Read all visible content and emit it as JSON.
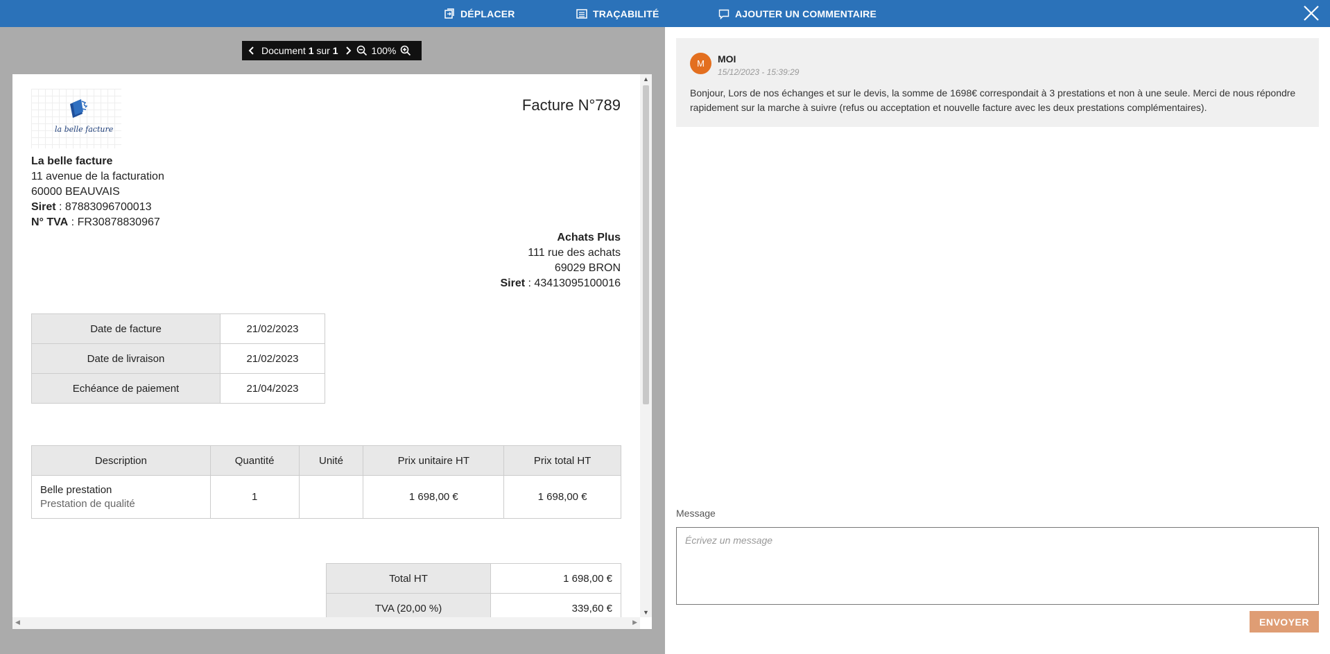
{
  "topbar": {
    "move_label": "DÉPLACER",
    "traceability_label": "TRAÇABILITÉ",
    "add_comment_label": "AJOUTER UN COMMENTAIRE"
  },
  "viewer": {
    "document_word": "Document",
    "current_page": "1",
    "of_word": "sur",
    "total_pages": "1",
    "zoom": "100%"
  },
  "invoice": {
    "title": "Facture N°789",
    "logo_text": "la belle facture",
    "sender": {
      "name": "La belle facture",
      "address1": "11 avenue de la facturation",
      "address2": "60000 BEAUVAIS",
      "siret_label": "Siret",
      "siret": "87883096700013",
      "vat_label": "N° TVA",
      "vat": "FR30878830967"
    },
    "recipient": {
      "name": "Achats Plus",
      "address1": "111 rue des achats",
      "address2": "69029 BRON",
      "siret_label": "Siret",
      "siret": "43413095100016"
    },
    "dates": [
      {
        "label": "Date de facture",
        "value": "21/02/2023"
      },
      {
        "label": "Date de livraison",
        "value": "21/02/2023"
      },
      {
        "label": "Echéance de paiement",
        "value": "21/04/2023"
      }
    ],
    "items_headers": [
      "Description",
      "Quantité",
      "Unité",
      "Prix unitaire HT",
      "Prix total HT"
    ],
    "items": [
      {
        "name": "Belle prestation",
        "detail": "Prestation de qualité",
        "quantity": "1",
        "unit": "",
        "unit_price": "1 698,00 €",
        "total": "1 698,00 €"
      }
    ],
    "totals": [
      {
        "label": "Total HT",
        "value": "1 698,00 €"
      },
      {
        "label": "TVA (20,00 %)",
        "value": "339,60 €"
      }
    ]
  },
  "comments": {
    "items": [
      {
        "avatar_letter": "M",
        "author": "MOI",
        "date": "15/12/2023 - 15:39:29",
        "text": "Bonjour, Lors de nos échanges et sur le devis, la somme de 1698€ correspondait à 3 prestations et non à une seule. Merci de nous répondre rapidement sur la marche à suivre (refus ou acceptation et nouvelle facture avec les deux prestations complémentaires)."
      }
    ],
    "message_label": "Message",
    "message_placeholder": "Écrivez un message",
    "send_label": "ENVOYER"
  },
  "colors": {
    "topbar": "#2b72b9",
    "avatar": "#e36f1f",
    "send_button": "#df9d74",
    "viewer_bg": "#ababab"
  }
}
